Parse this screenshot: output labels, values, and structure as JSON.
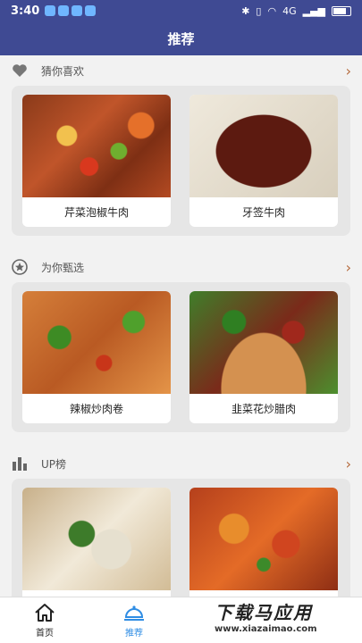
{
  "status_bar": {
    "time": "3:40",
    "network": "4G",
    "colors": {
      "bar": "#3f4a93"
    }
  },
  "header": {
    "title": "推荐"
  },
  "sections": [
    {
      "title": "猜你喜欢",
      "icon": "heart-icon",
      "items": [
        {
          "label": "芹菜泡椒牛肉"
        },
        {
          "label": "牙签牛肉"
        }
      ]
    },
    {
      "title": "为你甄选",
      "icon": "star-badge-icon",
      "items": [
        {
          "label": "辣椒炒肉卷"
        },
        {
          "label": "韭菜花炒腊肉"
        }
      ]
    },
    {
      "title": "UP榜",
      "icon": "bar-chart-icon",
      "items": [
        {
          "label": ""
        },
        {
          "label": ""
        }
      ]
    }
  ],
  "tabbar": {
    "items": [
      {
        "label": "首页",
        "icon": "home-icon"
      },
      {
        "label": "推荐",
        "icon": "cloche-icon",
        "active": true
      }
    ],
    "active_color": "#2f8de4"
  },
  "watermark": {
    "line1": "下载马应用",
    "line2": "www.xiazaimao.com"
  }
}
